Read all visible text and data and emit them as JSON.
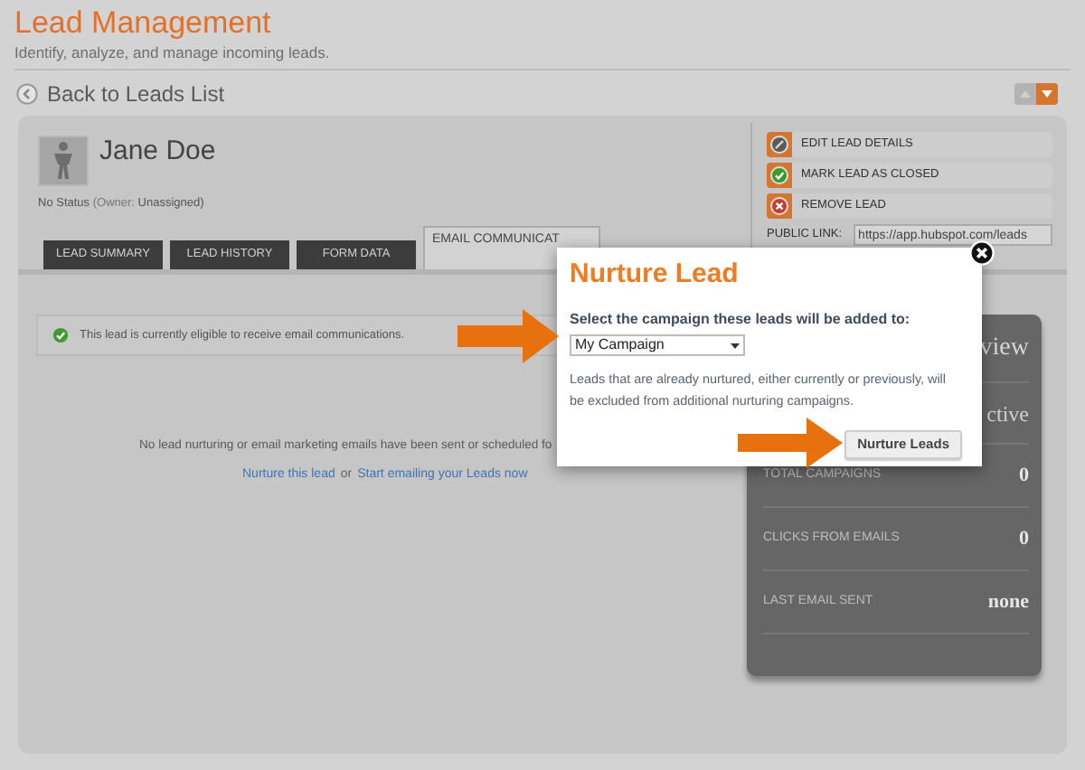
{
  "header": {
    "title": "Lead Management",
    "subtitle": "Identify, analyze, and manage incoming leads."
  },
  "back_link": "Back to Leads List",
  "lead": {
    "name": "Jane Doe",
    "status": "No Status",
    "owner_label": "(Owner:",
    "owner": "Unassigned)"
  },
  "actions": [
    {
      "kind": "edit",
      "label": "EDIT LEAD DETAILS"
    },
    {
      "kind": "close",
      "label": "MARK LEAD AS CLOSED"
    },
    {
      "kind": "remove",
      "label": "REMOVE LEAD"
    }
  ],
  "public_link": {
    "label": "PUBLIC LINK:",
    "value": "https://app.hubspot.com/leads"
  },
  "tabs": [
    {
      "label": "LEAD SUMMARY",
      "selected": false
    },
    {
      "label": "LEAD HISTORY",
      "selected": false
    },
    {
      "label": "FORM DATA",
      "selected": false
    },
    {
      "label": "EMAIL COMMUNICAT",
      "selected": true
    }
  ],
  "eligibility": "This lead is currently eligible to receive email communications.",
  "empty_message": "No lead nurturing or email marketing emails have been sent or scheduled fo",
  "links": {
    "first": "Nurture this lead",
    "joiner": "or",
    "second": "Start emailing your Leads now"
  },
  "stats": {
    "heading": "view",
    "status": "ctive",
    "rows": [
      {
        "label": "TOTAL CAMPAIGNS",
        "value": "0"
      },
      {
        "label": "CLICKS FROM EMAILS",
        "value": "0"
      },
      {
        "label": "LAST EMAIL SENT",
        "value": "none"
      }
    ]
  },
  "dialog": {
    "title": "Nurture Lead",
    "prompt": "Select the campaign these leads will be added to:",
    "campaign": "My Campaign",
    "note": "Leads that are already nurtured, either currently or previously, will be excluded from additional nurturing campaigns.",
    "button": "Nurture Leads"
  }
}
